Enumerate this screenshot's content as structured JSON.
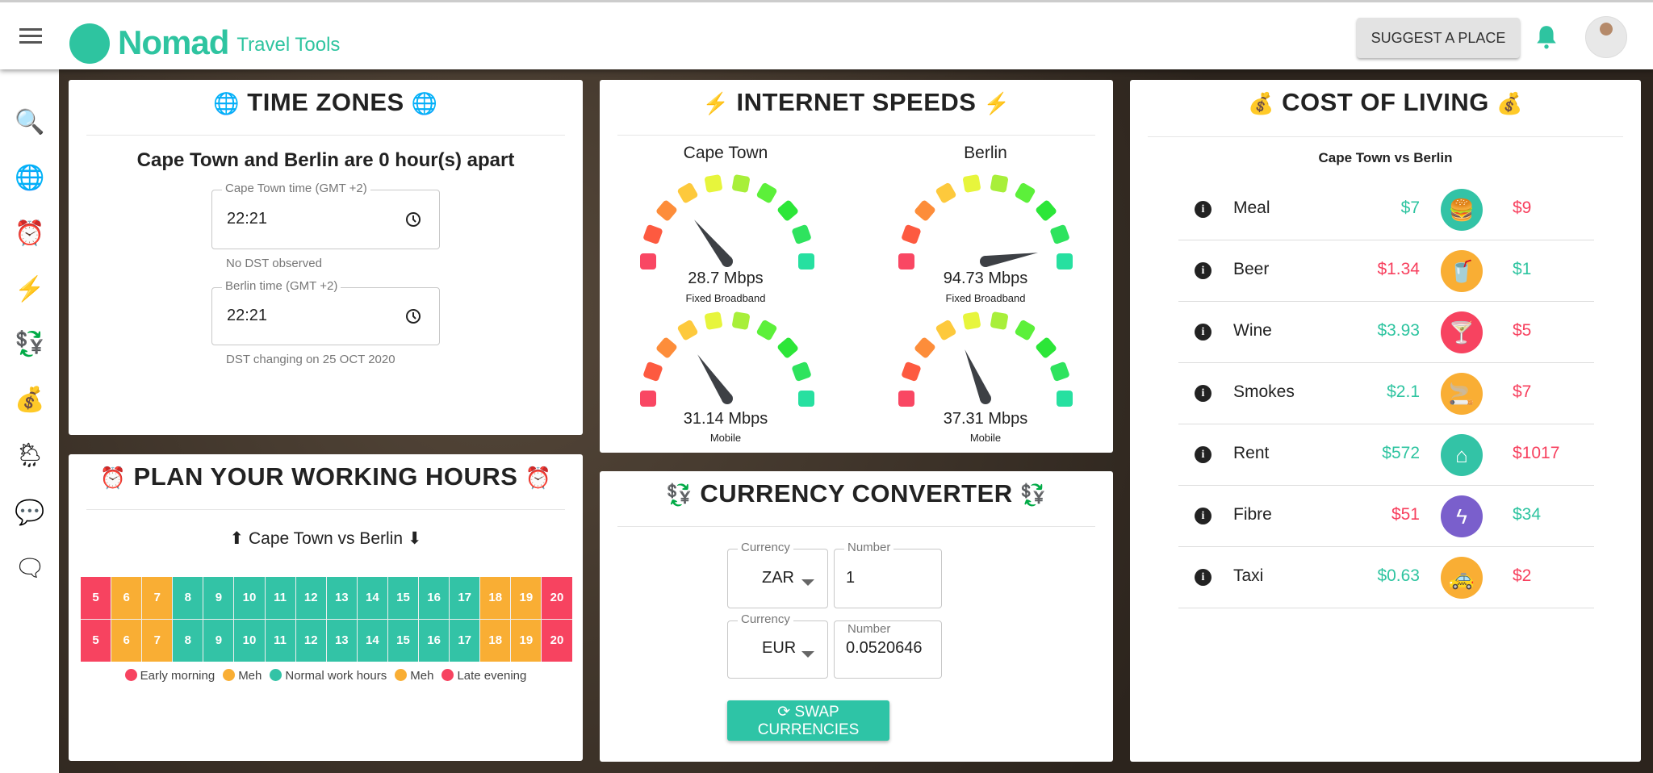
{
  "header": {
    "logo_name": "Nomad",
    "logo_sub": "Travel Tools",
    "suggest_label": "SUGGEST A PLACE"
  },
  "sidebar": {
    "items": [
      {
        "icon": "🔍",
        "name": "search"
      },
      {
        "icon": "🌐",
        "name": "time-zones"
      },
      {
        "icon": "⏰",
        "name": "working-hours"
      },
      {
        "icon": "⚡",
        "name": "internet-speeds"
      },
      {
        "icon": "💱",
        "name": "currency"
      },
      {
        "icon": "💰",
        "name": "cost-of-living"
      },
      {
        "icon": "🌦",
        "name": "weather"
      },
      {
        "icon": "💬",
        "name": "chat"
      },
      {
        "icon": "🗨",
        "name": "comments"
      }
    ]
  },
  "timezones": {
    "title": "TIME ZONES",
    "title_icon": "🌐",
    "summary": "Cape Town and Berlin are 0 hour(s) apart",
    "fields": [
      {
        "label": "Cape Town time (GMT +2)",
        "value": "22:21",
        "help": "No DST observed"
      },
      {
        "label": "Berlin time (GMT +2)",
        "value": "22:21",
        "help": "DST changing on 25 OCT 2020"
      }
    ]
  },
  "hours": {
    "title": "PLAN YOUR WORKING HOURS",
    "title_icon": "⏰",
    "subtitle_up": "⬆",
    "subtitle": "Cape Town vs Berlin",
    "subtitle_down": "⬇",
    "rows": [
      [
        5,
        6,
        7,
        8,
        9,
        10,
        11,
        12,
        13,
        14,
        15,
        16,
        17,
        18,
        19,
        20
      ],
      [
        5,
        6,
        7,
        8,
        9,
        10,
        11,
        12,
        13,
        14,
        15,
        16,
        17,
        18,
        19,
        20
      ]
    ],
    "categories": [
      "late",
      "meh",
      "meh",
      "work",
      "work",
      "work",
      "work",
      "work",
      "work",
      "work",
      "work",
      "work",
      "work",
      "meh",
      "meh",
      "late"
    ],
    "legend": [
      {
        "label": "Early morning",
        "color": "#f74360"
      },
      {
        "label": "Meh",
        "color": "#f9ae34"
      },
      {
        "label": "Normal work hours",
        "color": "#33c3a6"
      },
      {
        "label": "Meh",
        "color": "#f9ae34"
      },
      {
        "label": "Late evening",
        "color": "#f74360"
      }
    ],
    "colors": {
      "late": "#f74360",
      "meh": "#f9ae34",
      "work": "#33c3a6"
    }
  },
  "internet": {
    "title": "INTERNET SPEEDS",
    "title_icon": "⚡",
    "cities": [
      "Cape Town",
      "Berlin"
    ],
    "gauges": [
      {
        "value": 28.7,
        "text": "28.7 Mbps",
        "label": "Fixed Broadband"
      },
      {
        "value": 94.73,
        "text": "94.73 Mbps",
        "label": "Fixed Broadband"
      },
      {
        "value": 31.14,
        "text": "31.14 Mbps",
        "label": "Mobile"
      },
      {
        "value": 37.31,
        "text": "37.31 Mbps",
        "label": "Mobile"
      }
    ],
    "segment_colors": [
      "#f94763",
      "#fd5a40",
      "#fd8d3a",
      "#fdc93c",
      "#e7f53c",
      "#a8ef3a",
      "#5cf03a",
      "#2ce638",
      "#2ee35e",
      "#27e0a0"
    ]
  },
  "currency": {
    "title": "CURRENCY CONVERTER",
    "title_icon": "💱",
    "rows": [
      {
        "currency_label": "Currency",
        "currency": "ZAR",
        "number_label": "Number",
        "number": "1"
      },
      {
        "currency_label": "Currency",
        "currency": "EUR",
        "number_label": "Number",
        "number": "0.0520646"
      }
    ],
    "swap_label": "SWAP CURRENCIES"
  },
  "cost": {
    "title": "COST OF LIVING",
    "title_icon": "💰",
    "subtitle": "Cape Town vs Berlin",
    "cheaper_color": "#2ec4a0",
    "pricier_color": "#f7405e",
    "items": [
      {
        "name": "Meal",
        "left": "$7",
        "right": "$9",
        "cheaper": "left",
        "icon": "🍔",
        "icon_name": "fast-food-icon",
        "color": "#33c3a6"
      },
      {
        "name": "Beer",
        "left": "$1.34",
        "right": "$1",
        "cheaper": "right",
        "icon": "🥤",
        "icon_name": "cup-icon",
        "color": "#f9ae34"
      },
      {
        "name": "Wine",
        "left": "$3.93",
        "right": "$5",
        "cheaper": "left",
        "icon": "🍸",
        "icon_name": "cocktail-icon",
        "color": "#f74360"
      },
      {
        "name": "Smokes",
        "left": "$2.1",
        "right": "$7",
        "cheaper": "left",
        "icon": "🚬",
        "icon_name": "smoking-icon",
        "color": "#f9ae34"
      },
      {
        "name": "Rent",
        "left": "$572",
        "right": "$1017",
        "cheaper": "left",
        "icon": "⌂",
        "icon_name": "home-icon",
        "color": "#33c3a6"
      },
      {
        "name": "Fibre",
        "left": "$51",
        "right": "$34",
        "cheaper": "right",
        "icon": "ϟ",
        "icon_name": "bolt-icon",
        "color": "#7a5fcc"
      },
      {
        "name": "Taxi",
        "left": "$0.63",
        "right": "$2",
        "cheaper": "left",
        "icon": "🚕",
        "icon_name": "taxi-icon",
        "color": "#f9ae34"
      }
    ]
  }
}
